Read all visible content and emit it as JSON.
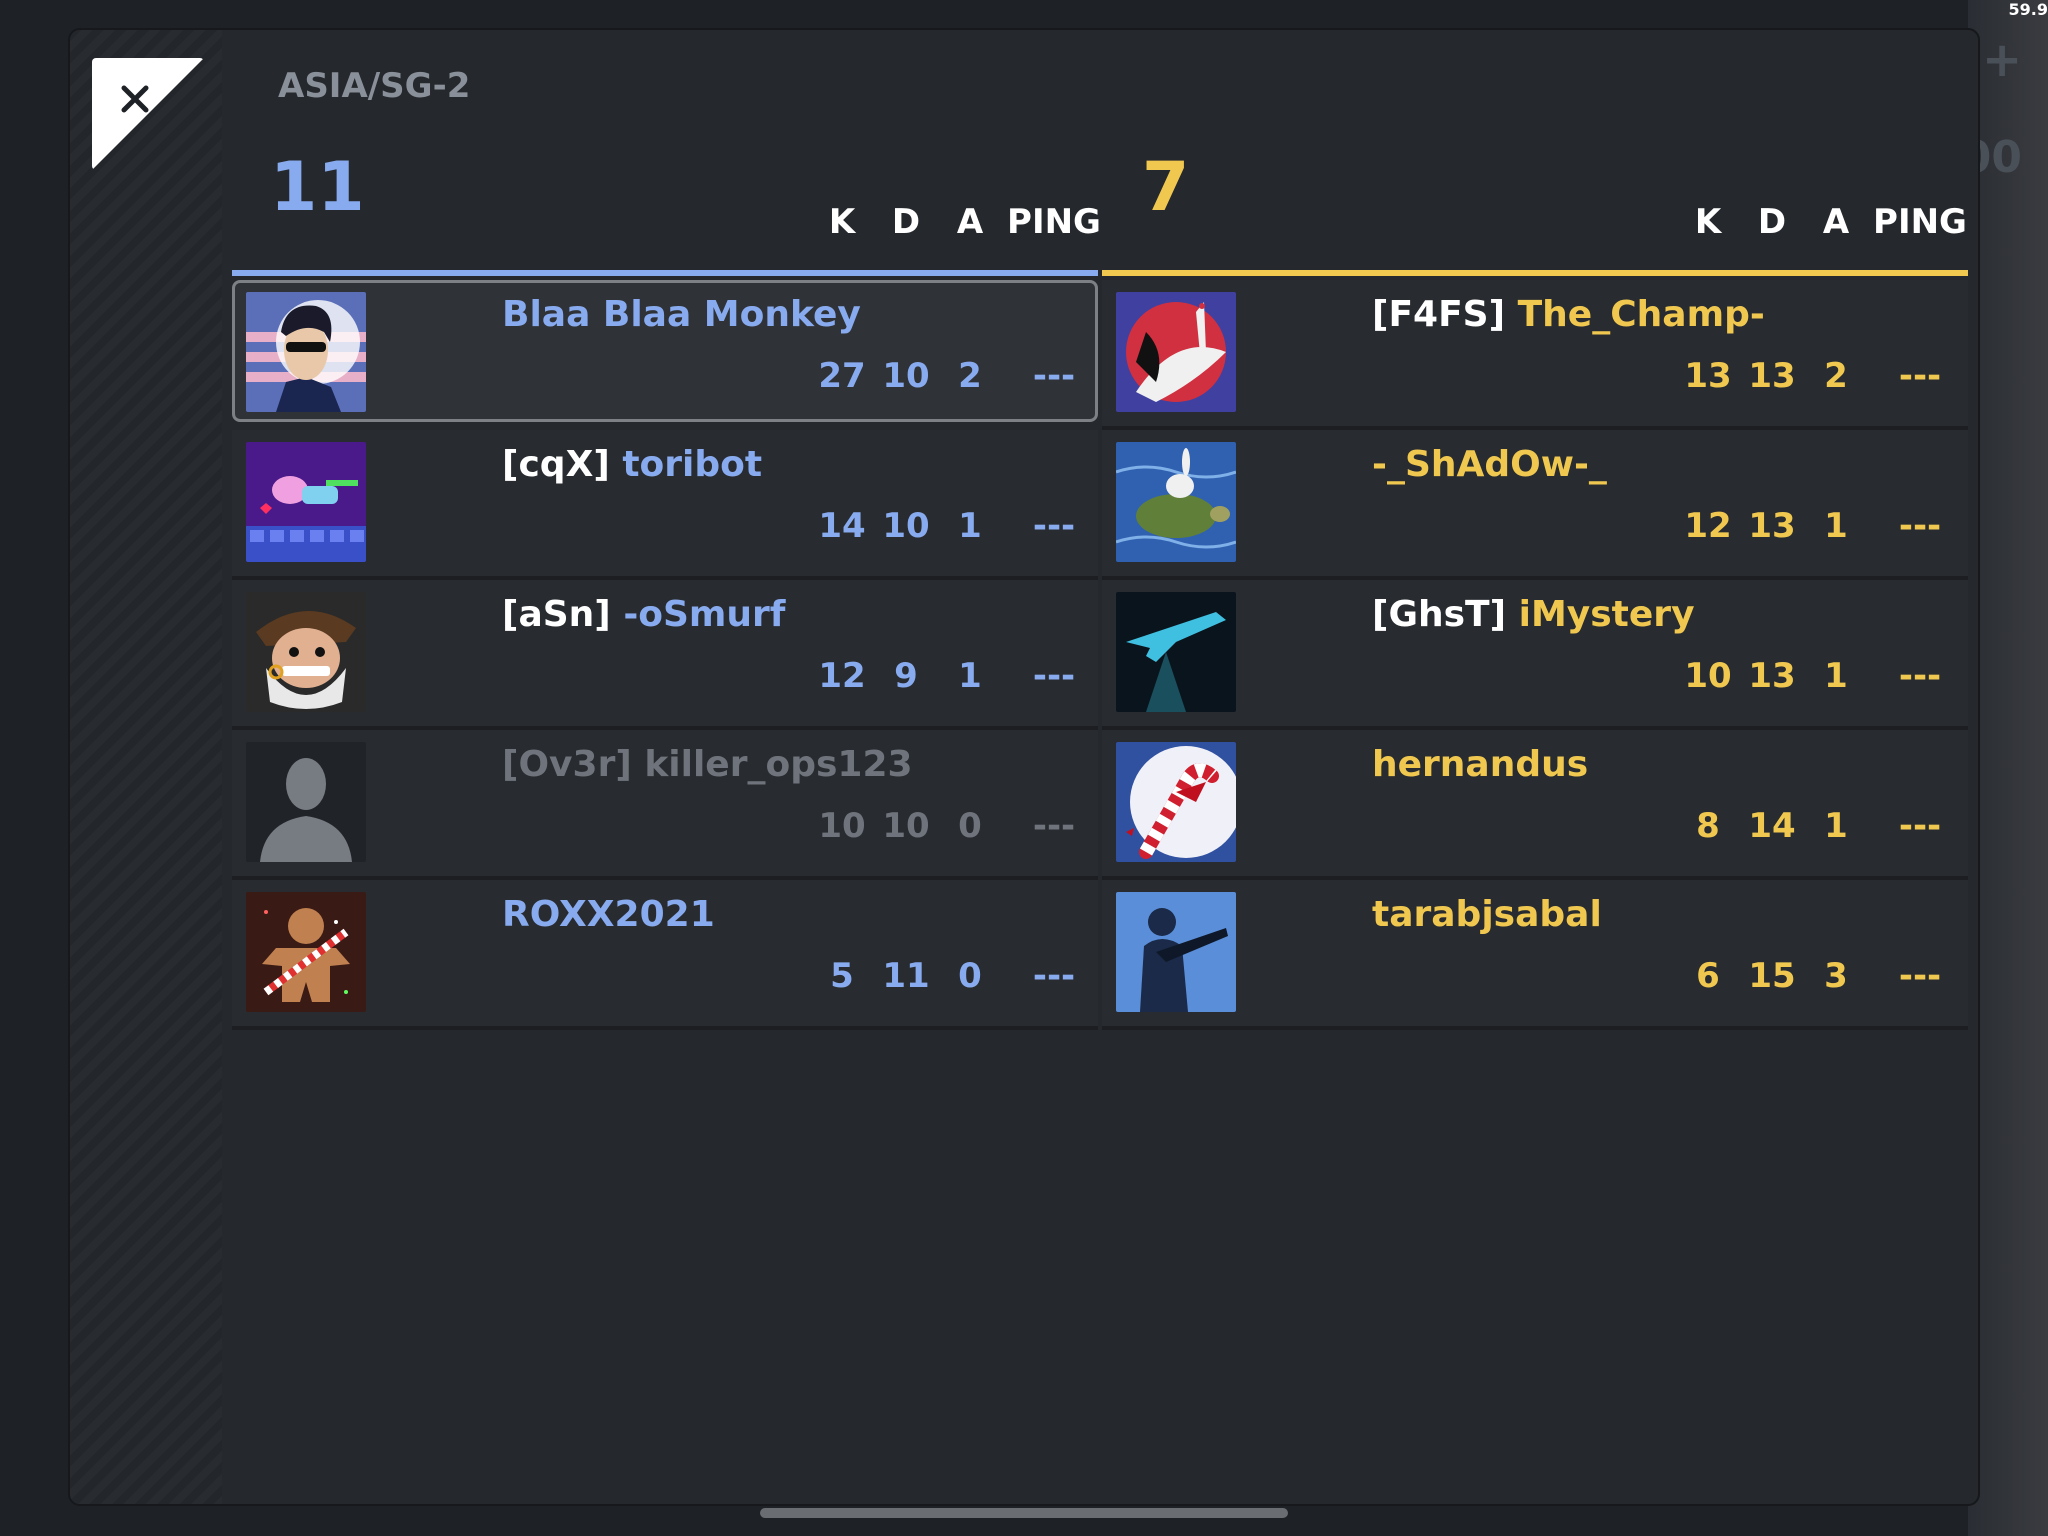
{
  "status": {
    "fps": "59.9"
  },
  "server": {
    "region": "ASIA/SG-2"
  },
  "columns": {
    "k": "K",
    "d": "D",
    "a": "A",
    "ping": "PING"
  },
  "teams": [
    {
      "score": "11",
      "color": "#88aaee",
      "players": [
        {
          "clan": "",
          "name": "Blaa Blaa Monkey",
          "k": "27",
          "d": "10",
          "a": "2",
          "ping": "---",
          "avatar": "sunglasses-man-avatar",
          "selected": true
        },
        {
          "clan": "[cqX]",
          "name": "toribot",
          "k": "14",
          "d": "10",
          "a": "1",
          "ping": "---",
          "avatar": "pixel-art-avatar"
        },
        {
          "clan": "[aSn]",
          "name": "-oSmurf",
          "k": "12",
          "d": "9",
          "a": "1",
          "ping": "---",
          "avatar": "pirate-avatar"
        },
        {
          "clan": "[Ov3r]",
          "name": "killer_ops123",
          "k": "10",
          "d": "10",
          "a": "0",
          "ping": "---",
          "avatar": "default-silhouette-avatar",
          "inactive": true
        },
        {
          "clan": "",
          "name": "ROXX2021",
          "k": "5",
          "d": "11",
          "a": "0",
          "ping": "---",
          "avatar": "gingerbread-avatar"
        }
      ]
    },
    {
      "score": "7",
      "color": "#f0c850",
      "players": [
        {
          "clan": "[F4FS]",
          "name": "The_Champ-",
          "k": "13",
          "d": "13",
          "a": "2",
          "ping": "---",
          "avatar": "crane-avatar"
        },
        {
          "clan": "",
          "name": "-_ShAdOw-_",
          "k": "12",
          "d": "13",
          "a": "1",
          "ping": "---",
          "avatar": "turtle-rabbit-avatar"
        },
        {
          "clan": "[GhsT]",
          "name": "iMystery",
          "k": "10",
          "d": "13",
          "a": "1",
          "ping": "---",
          "avatar": "rifle-hologram-avatar"
        },
        {
          "clan": "",
          "name": "hernandus",
          "k": "8",
          "d": "14",
          "a": "1",
          "ping": "---",
          "avatar": "candy-cane-avatar"
        },
        {
          "clan": "",
          "name": "tarabjsabal",
          "k": "6",
          "d": "15",
          "a": "3",
          "ping": "---",
          "avatar": "soldier-avatar"
        }
      ]
    }
  ]
}
